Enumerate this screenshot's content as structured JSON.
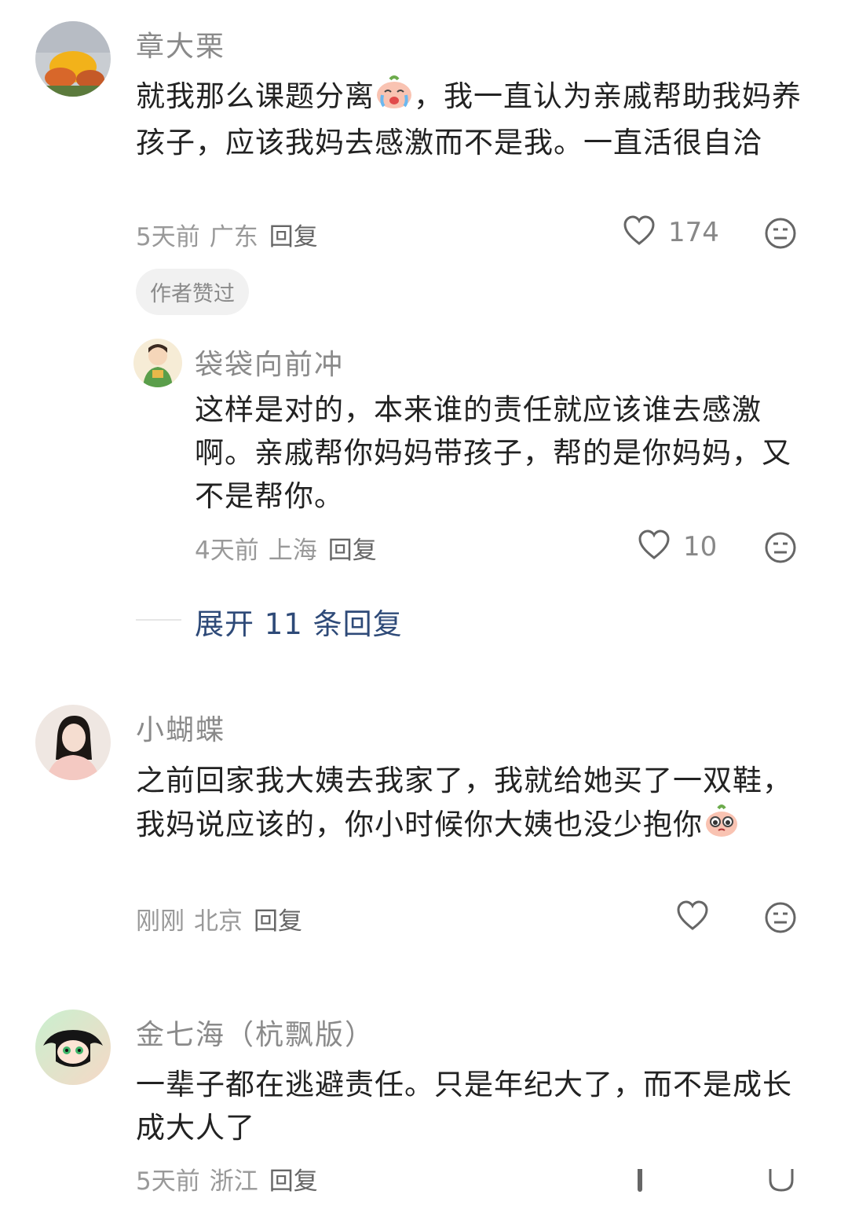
{
  "comments": [
    {
      "username": "章大栗",
      "text_a": "就我那么课题分离",
      "text_b": "，我一直认为亲戚帮助我妈养孩子，应该我妈去感激而不是我。一直活很自洽",
      "time": "5天前",
      "location": "广东",
      "reply": "回复",
      "likes": "174",
      "badge": "作者赞过",
      "emoji": "crying-face-emoji"
    },
    {
      "username": "小蝴蝶",
      "text_a": "之前回家我大姨去我家了，我就给她买了一双鞋，我妈说应该的，你小时候你大姨也没少抱你",
      "time": "刚刚",
      "location": "北京",
      "reply": "回复",
      "emoji": "pleading-face-emoji"
    },
    {
      "username": "金七海（杭飘版）",
      "text_a": "一辈子都在逃避责任。只是年纪大了，而不是成长成大人了",
      "time": "5天前",
      "location": "浙江",
      "reply": "回复"
    }
  ],
  "reply_thread": {
    "username": "袋袋向前冲",
    "text": "这样是对的，本来谁的责任就应该谁去感激啊。亲戚帮你妈妈带孩子，帮的是你妈妈，又不是帮你。",
    "time": "4天前",
    "location": "上海",
    "reply": "回复",
    "likes": "10"
  },
  "expand_replies": "展开 11 条回复",
  "icons": {
    "like": "heart-outline-icon",
    "dislike": "meh-face-icon"
  },
  "colors": {
    "link": "#2e4a78",
    "meta": "#999999",
    "username": "#8a8a8a"
  }
}
